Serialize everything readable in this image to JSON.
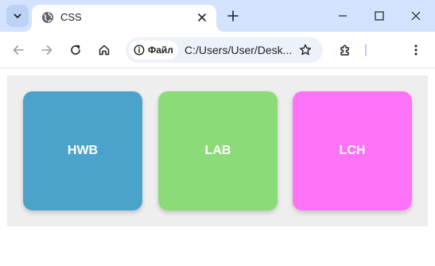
{
  "browser": {
    "tab": {
      "title": "CSS",
      "favicon": "globe-icon"
    },
    "window_controls": [
      "minimize-icon",
      "maximize-icon",
      "close-icon"
    ],
    "toolbar": {
      "site_chip_label": "Файл",
      "url": "C:/Users/User/Desk..."
    }
  },
  "page": {
    "boxes": [
      {
        "label": "HWB",
        "color": "#4ba3cc"
      },
      {
        "label": "LAB",
        "color": "#8bdb78"
      },
      {
        "label": "LCH",
        "color": "#ff73f7"
      }
    ],
    "container_color": "#eeeeee"
  }
}
